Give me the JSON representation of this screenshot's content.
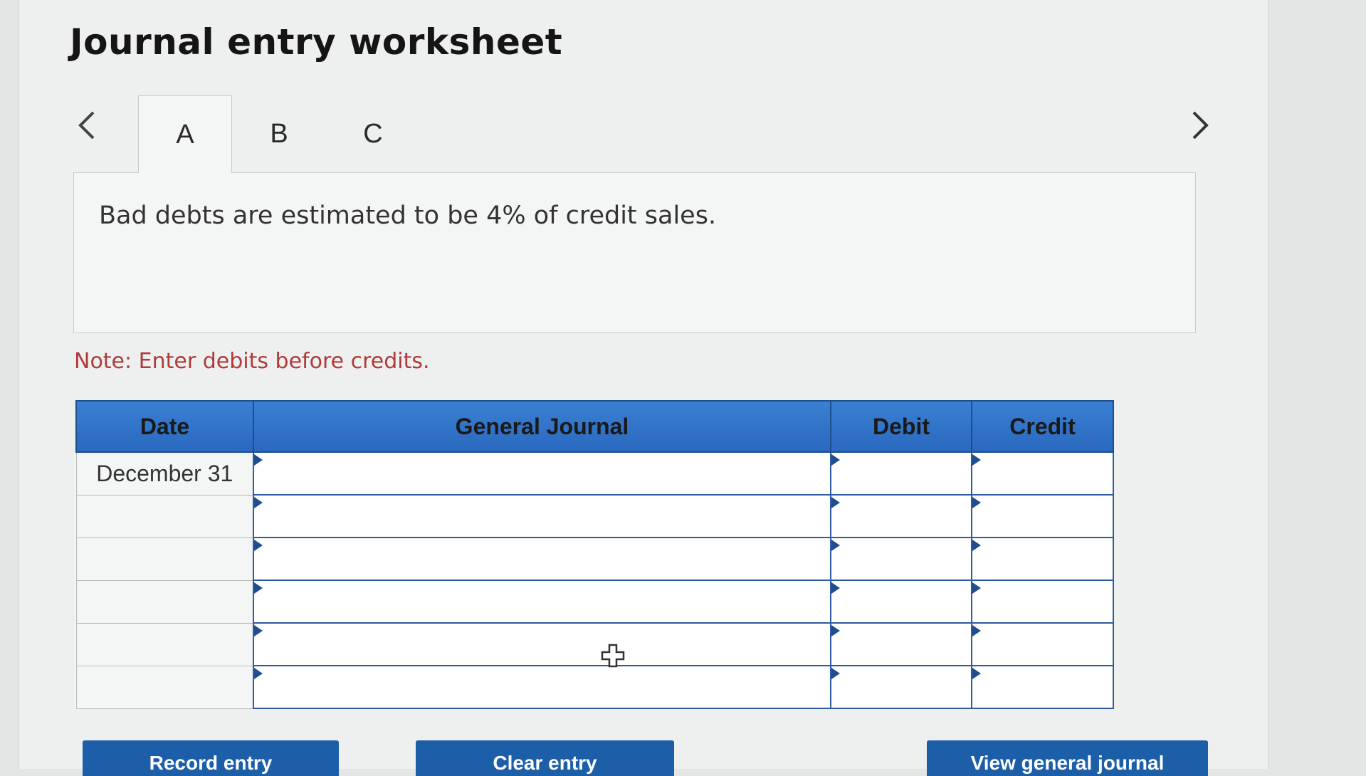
{
  "title": "Journal entry worksheet",
  "nav": {
    "prev_icon": "chevron-left-icon",
    "next_icon": "chevron-right-icon"
  },
  "tabs": [
    {
      "label": "A",
      "active": true
    },
    {
      "label": "B",
      "active": false
    },
    {
      "label": "C",
      "active": false
    }
  ],
  "description": "Bad debts are estimated to be 4% of credit sales.",
  "note": "Note: Enter debits before credits.",
  "table": {
    "headers": {
      "date": "Date",
      "general_journal": "General Journal",
      "debit": "Debit",
      "credit": "Credit"
    },
    "rows": [
      {
        "date": "December 31",
        "account": "",
        "debit": "",
        "credit": ""
      },
      {
        "date": "",
        "account": "",
        "debit": "",
        "credit": ""
      },
      {
        "date": "",
        "account": "",
        "debit": "",
        "credit": ""
      },
      {
        "date": "",
        "account": "",
        "debit": "",
        "credit": ""
      },
      {
        "date": "",
        "account": "",
        "debit": "",
        "credit": ""
      },
      {
        "date": "",
        "account": "",
        "debit": "",
        "credit": ""
      }
    ]
  },
  "buttons": {
    "record": "Record entry",
    "clear": "Clear entry",
    "view": "View general journal"
  },
  "colors": {
    "header_blue": "#2a69bf",
    "border_blue": "#2d5aa0",
    "button_blue": "#1d5ea8",
    "note_red": "#b03a3a"
  }
}
